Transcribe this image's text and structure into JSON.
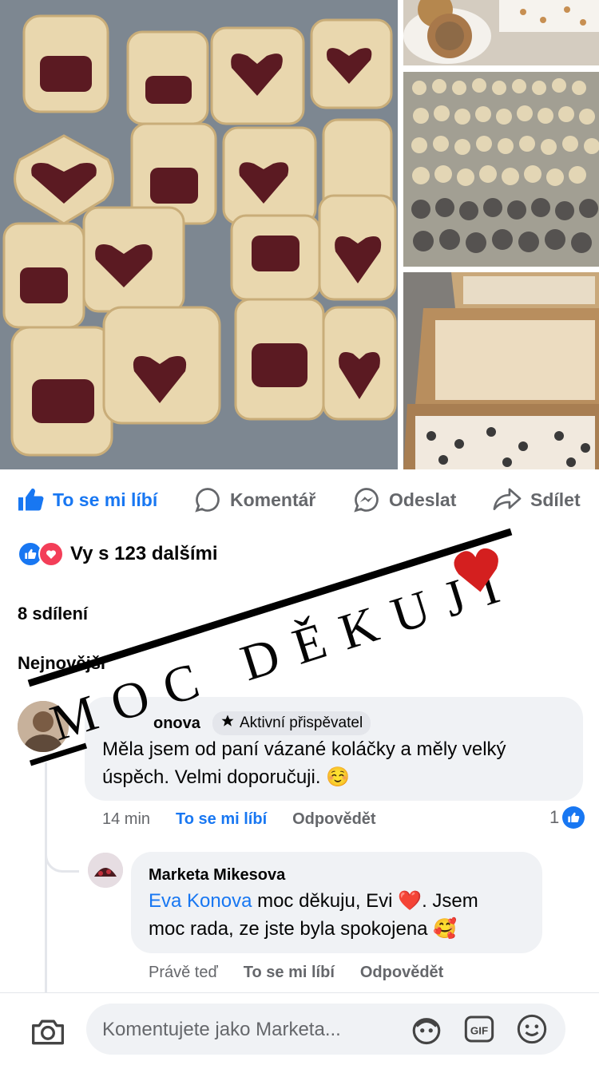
{
  "post": {
    "photos": [
      {
        "icon": "cookie-photo-icon"
      },
      {
        "icon": "tart-photo-icon"
      },
      {
        "icon": "small-cakes-tray-photo-icon"
      },
      {
        "icon": "boxes-of-cookies-photo-icon"
      }
    ]
  },
  "actions": {
    "like": "To se mi líbí",
    "comment": "Komentář",
    "send": "Odeslat",
    "share": "Sdílet"
  },
  "reactions": {
    "summary": "Vy s 123 dalšími"
  },
  "shares": "8 sdílení",
  "sort_label": "Nejnovější",
  "overlay_text": "MOC DĚKUJI",
  "comments": [
    {
      "name_fragment": "onova",
      "badge": "Aktivní přispěvatel",
      "text_line1": "Měla jsem od paní vázané koláčky a měly velký",
      "text_line2": "úspěch. Velmi doporučuji.",
      "emoji": "☺️",
      "time": "14 min",
      "like": "To se mi líbí",
      "reply": "Odpovědět",
      "like_count": "1"
    },
    {
      "name": "Marketa Mikesova",
      "mention": "Eva Konova",
      "text_a": " moc děkuju, Evi ",
      "heart": "❤️",
      "text_b": ". Jsem",
      "text_line2": "moc rada, ze jste byla spokojena",
      "emoji": "🥰",
      "time": "Právě teď",
      "like": "To se mi líbí",
      "reply": "Odpovědět"
    }
  ],
  "composer": {
    "placeholder": "Komentujete jako Marketa..."
  },
  "colors": {
    "accent": "#1877f2",
    "love": "#f33e58",
    "muted": "#65676b"
  }
}
